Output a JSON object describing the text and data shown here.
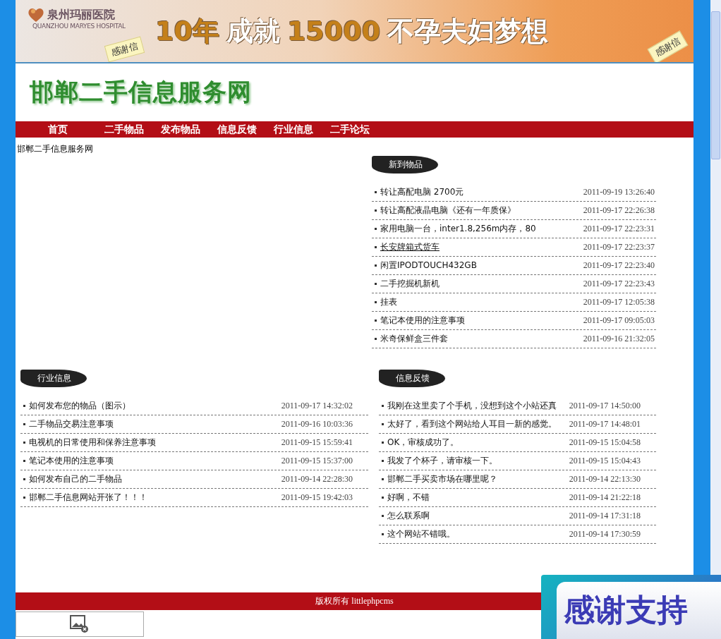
{
  "banner": {
    "brand": "泉州玛丽医院",
    "brand_en": "QUANZHOU MARYES HOSPITAL",
    "slogan": [
      {
        "text": "10年",
        "kind": "accent"
      },
      {
        "text": "成就",
        "kind": "plain"
      },
      {
        "text": "15000",
        "kind": "accent"
      },
      {
        "text": "不孕夫妇梦想",
        "kind": "plain"
      }
    ],
    "notes": [
      "感谢信",
      "感谢信"
    ]
  },
  "site_title": "邯郸二手信息服务网",
  "nav": [
    {
      "label": "首页"
    },
    {
      "label": "二手物品"
    },
    {
      "label": "发布物品"
    },
    {
      "label": "信息反馈"
    },
    {
      "label": "行业信息"
    },
    {
      "label": "二手论坛"
    }
  ],
  "intro": "邯郸二手信息服务网",
  "new_items": {
    "title": "新到物品",
    "items": [
      {
        "title": "转让高配电脑 2700元",
        "time": "2011-09-19 13:26:40",
        "hovered": false
      },
      {
        "title": "转让高配液晶电脑《还有一年质保》",
        "time": "2011-09-17 22:26:38",
        "hovered": false
      },
      {
        "title": "家用电脑一台，inter1.8,256m内存，80",
        "time": "2011-09-17 22:23:31",
        "hovered": false
      },
      {
        "title": "长安牌箱式货车",
        "time": "2011-09-17 22:23:37",
        "hovered": true
      },
      {
        "title": "闲置IPODTOUCH432GB",
        "time": "2011-09-17 22:23:40",
        "hovered": false
      },
      {
        "title": "二手挖掘机新机",
        "time": "2011-09-17 22:23:43",
        "hovered": false
      },
      {
        "title": "挂表",
        "time": "2011-09-17 12:05:38",
        "hovered": false
      },
      {
        "title": "笔记本使用的注意事项",
        "time": "2011-09-17 09:05:03",
        "hovered": false
      },
      {
        "title": "米奇保鲜盒三件套",
        "time": "2011-09-16 21:32:05",
        "hovered": false
      }
    ]
  },
  "industry": {
    "title": "行业信息",
    "items": [
      {
        "title": "如何发布您的物品（图示）",
        "time": "2011-09-17 14:32:02"
      },
      {
        "title": "二手物品交易注意事项",
        "time": "2011-09-16 10:03:36"
      },
      {
        "title": "电视机的日常使用和保养注意事项",
        "time": "2011-09-15 15:59:41"
      },
      {
        "title": "笔记本使用的注意事项",
        "time": "2011-09-15 15:37:00"
      },
      {
        "title": "如何发布自己的二手物品",
        "time": "2011-09-14 22:28:30"
      },
      {
        "title": "邯郸二手信息网站开张了！！！",
        "time": "2011-09-15 19:42:03"
      }
    ]
  },
  "feedback": {
    "title": "信息反馈",
    "items": [
      {
        "title": "我刚在这里卖了个手机，没想到这个小站还真",
        "time": "2011-09-17 14:50:00"
      },
      {
        "title": "太好了，看到这个网站给人耳目一新的感觉。",
        "time": "2011-09-17 14:48:01"
      },
      {
        "title": "OK，审核成功了。",
        "time": "2011-09-15 15:04:58"
      },
      {
        "title": "我发了个杯子，请审核一下。",
        "time": "2011-09-15 15:04:43"
      },
      {
        "title": "邯郸二手买卖市场在哪里呢？",
        "time": "2011-09-14 22:13:30"
      },
      {
        "title": "好啊，不错",
        "time": "2011-09-14 21:22:18"
      },
      {
        "title": "怎么联系啊",
        "time": "2011-09-14 17:31:18"
      },
      {
        "title": "这个网站不错哦。",
        "time": "2011-09-14 17:30:59"
      }
    ]
  },
  "footer": "版权所有 littlephpcms",
  "popup_ad": {
    "text": "感谢支持"
  }
}
